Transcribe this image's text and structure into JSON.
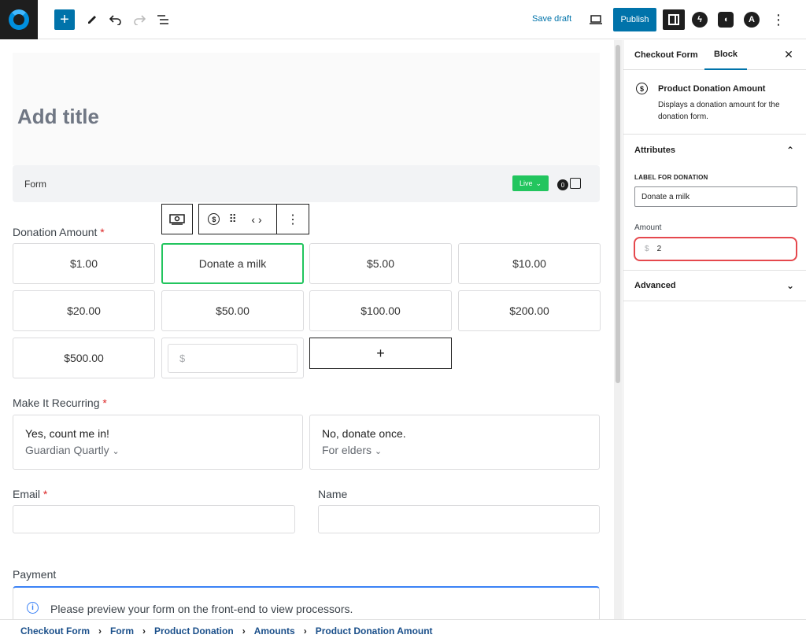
{
  "toolbar": {
    "add_icon": "plus-icon",
    "save_draft": "Save draft",
    "publish": "Publish"
  },
  "canvas": {
    "title_placeholder": "Add title",
    "form_label": "Form",
    "live_badge": "Live",
    "cart_count": "0",
    "donation_label": "Donation Amount",
    "required_mark": "*",
    "amounts": [
      "$1.00",
      "Donate a milk",
      "$5.00",
      "$10.00",
      "$20.00",
      "$50.00",
      "$100.00",
      "$200.00",
      "$500.00"
    ],
    "custom_amount_prefix": "$",
    "add_amount": "+",
    "recurring_label": "Make It Recurring",
    "recurring_options": [
      {
        "title": "Yes, count me in!",
        "subtitle": "Guardian Quartly"
      },
      {
        "title": "No, donate once.",
        "subtitle": "For elders"
      }
    ],
    "email_label": "Email",
    "name_label": "Name",
    "payment_label": "Payment",
    "payment_notice": "Please preview your form on the front-end to view processors."
  },
  "breadcrumb": [
    "Checkout Form",
    "Form",
    "Product Donation",
    "Amounts",
    "Product Donation Amount"
  ],
  "sidebar": {
    "tabs": [
      "Checkout Form",
      "Block"
    ],
    "active_tab": "Block",
    "block_title": "Product Donation Amount",
    "block_desc": "Displays a donation amount for the donation form.",
    "attributes_title": "Attributes",
    "label_for_donation": "LABEL FOR DONATION",
    "label_value": "Donate a milk",
    "amount_label": "Amount",
    "amount_prefix": "$",
    "amount_value": "2",
    "advanced_title": "Advanced"
  },
  "colors": {
    "accent": "#0073aa",
    "live": "#22c55e",
    "selected": "#22c55e",
    "highlight": "#e5484d"
  }
}
